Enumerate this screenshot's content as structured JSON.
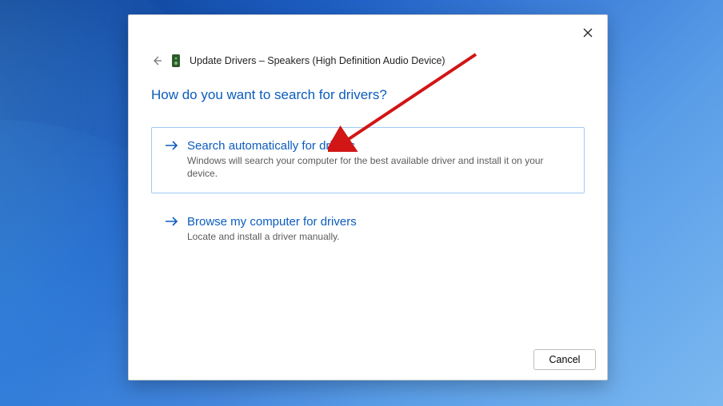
{
  "dialog": {
    "title": "Update Drivers – Speakers (High Definition Audio Device)",
    "prompt": "How do you want to search for drivers?",
    "options": [
      {
        "title": "Search automatically for drivers",
        "desc": "Windows will search your computer for the best available driver and install it on your device."
      },
      {
        "title": "Browse my computer for drivers",
        "desc": "Locate and install a driver manually."
      }
    ],
    "cancel_label": "Cancel"
  }
}
